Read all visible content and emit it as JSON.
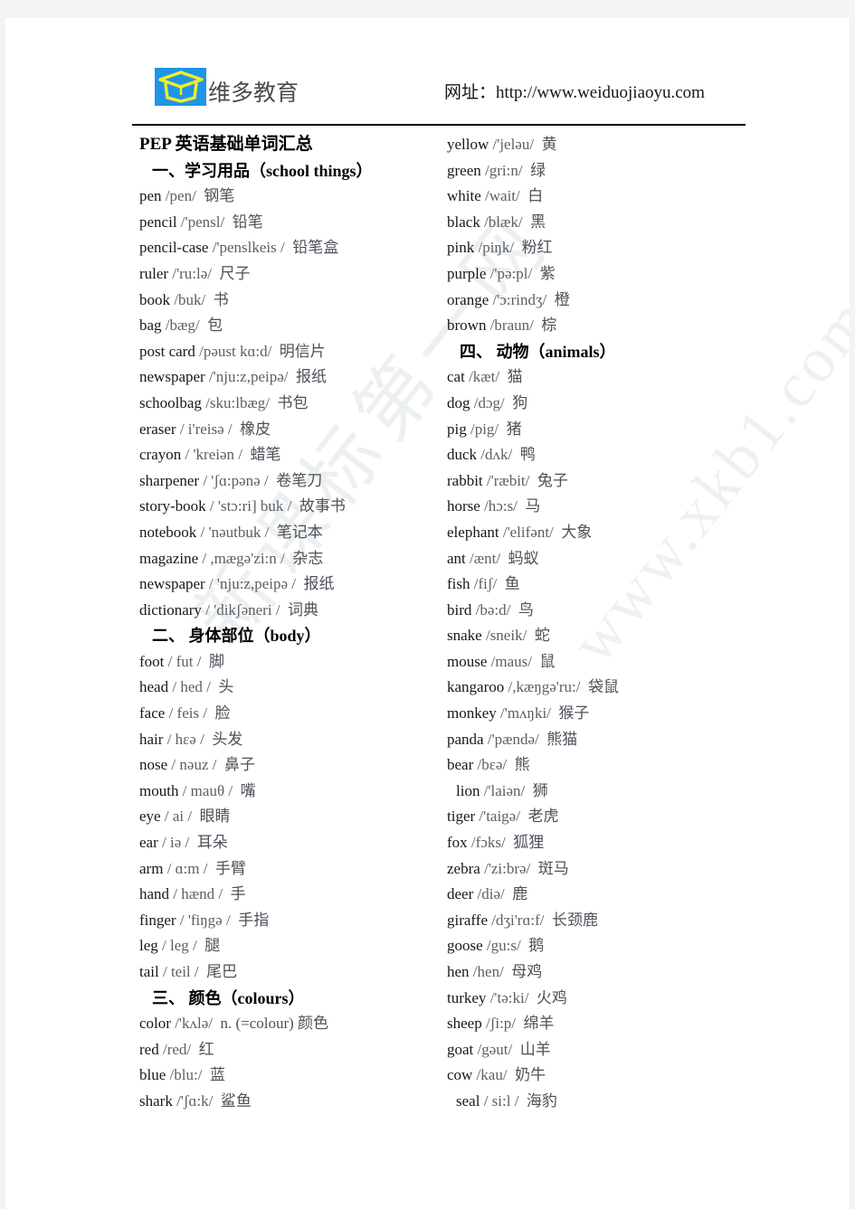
{
  "header": {
    "logo_icon": "graduation-cap-logo-icon",
    "brand_name": "维多教育",
    "site_url": "网址：http://www.weiduojiaoyu.com",
    "logo_bg_color": "#1f95e8",
    "logo_mark_color": "#f7ee22"
  },
  "watermarks": {
    "chinese": "新课标第一网",
    "english": "www.xkb1.com"
  },
  "document": {
    "title": "PEP 英语基础单词汇总"
  },
  "left_column": [
    {
      "type": "title",
      "text": "PEP 英语基础单词汇总"
    },
    {
      "type": "section",
      "text": "一、学习用品（school  things）"
    },
    {
      "type": "entry",
      "word": "pen",
      "ipa": "/pen/",
      "cn": "钢笔"
    },
    {
      "type": "entry",
      "word": "pencil",
      "ipa": "/'pensl/",
      "cn": "铅笔"
    },
    {
      "type": "entry",
      "word": "pencil-case",
      "ipa": "/'penslkeis /",
      "cn": "铅笔盒"
    },
    {
      "type": "entry",
      "word": "ruler",
      "ipa": "/'ru:lə/",
      "cn": "尺子"
    },
    {
      "type": "entry",
      "word": "book",
      "ipa": "/buk/",
      "cn": "书"
    },
    {
      "type": "entry",
      "word": "bag",
      "ipa": "/bæg/",
      "cn": "包"
    },
    {
      "type": "entry",
      "word": "post card",
      "ipa": "/pəust kɑ:d/",
      "cn": "明信片"
    },
    {
      "type": "entry",
      "word": "newspaper",
      "ipa": "/'nju:z,peipə/",
      "cn": "报纸"
    },
    {
      "type": "entry",
      "word": "schoolbag",
      "ipa": "/sku:lbæg/",
      "cn": "书包"
    },
    {
      "type": "entry",
      "word": "eraser",
      "ipa": "/ i'reisə /",
      "cn": "橡皮"
    },
    {
      "type": "entry",
      "word": "crayon",
      "ipa": "/ 'kreiən /",
      "cn": "蜡笔"
    },
    {
      "type": "entry",
      "word": "sharpener",
      "ipa": "/ 'ʃɑ:pənə /",
      "cn": "卷笔刀"
    },
    {
      "type": "entry",
      "word": "story-book",
      "ipa": "/ 'stɔ:ri] buk /",
      "cn": "故事书"
    },
    {
      "type": "entry",
      "word": "notebook",
      "ipa": "/ 'nəutbuk /",
      "cn": "笔记本"
    },
    {
      "type": "entry",
      "word": "magaᴢine",
      "ipa": "/ ,mægə'zi:n /",
      "cn": "杂志"
    },
    {
      "type": "entry",
      "word": "newspaper",
      "ipa": "/ 'nju:ᴢ,peipə /",
      "cn": "报纸"
    },
    {
      "type": "entry",
      "word": "dictionary",
      "ipa": "/ 'dikʃəneri /",
      "cn": "词典"
    },
    {
      "type": "section",
      "text": "二、 身体部位（body）"
    },
    {
      "type": "entry",
      "word": "foot",
      "ipa": "/ fut /",
      "cn": "脚"
    },
    {
      "type": "entry",
      "word": "head",
      "ipa": "/ hed /",
      "cn": "头"
    },
    {
      "type": "entry",
      "word": "face",
      "ipa": "/ feis /",
      "cn": "脸"
    },
    {
      "type": "entry",
      "word": "hair",
      "ipa": "/ hɛə /",
      "cn": "头发"
    },
    {
      "type": "entry",
      "word": "nose",
      "ipa": "/ nəuz /",
      "cn": "鼻子"
    },
    {
      "type": "entry",
      "word": "mouth",
      "ipa": "/ mauθ /",
      "cn": "嘴"
    },
    {
      "type": "entry",
      "word": "eye",
      "ipa": "/ ai /",
      "cn": "眼睛"
    },
    {
      "type": "entry",
      "word": "ear",
      "ipa": "/ iə /",
      "cn": "耳朵"
    },
    {
      "type": "entry",
      "word": "arm",
      "ipa": "/ ɑ:m /",
      "cn": "手臂"
    },
    {
      "type": "entry",
      "word": "hand",
      "ipa": "/ hænd /",
      "cn": "手"
    },
    {
      "type": "entry",
      "word": "finger",
      "ipa": "/ 'fiŋgə /",
      "cn": "手指"
    },
    {
      "type": "entry",
      "word": "leg",
      "ipa": "/ leg /",
      "cn": "腿"
    },
    {
      "type": "entry",
      "word": "tail",
      "ipa": "/ teil /",
      "cn": "尾巴"
    },
    {
      "type": "section",
      "text": "三、 颜色（colours）"
    },
    {
      "type": "entry",
      "word": "color",
      "ipa": "/'kʌlə/",
      "cn": "n. (=colour) 颜色"
    },
    {
      "type": "entry",
      "word": "red",
      "ipa": "/red/",
      "cn": "红"
    },
    {
      "type": "entry",
      "word": "blue",
      "ipa": "/blu:/",
      "cn": "蓝"
    },
    {
      "type": "entry",
      "word": "shark",
      "ipa": "/'ʃɑ:k/",
      "cn": "鲨鱼"
    }
  ],
  "right_column": [
    {
      "type": "entry",
      "word": "yellow",
      "ipa": "/'jeləu/",
      "cn": "黄"
    },
    {
      "type": "entry",
      "word": "green",
      "ipa": "/gri:n/",
      "cn": "绿"
    },
    {
      "type": "entry",
      "word": "white",
      "ipa": "/wait/",
      "cn": "白"
    },
    {
      "type": "entry",
      "word": "black",
      "ipa": "/blæk/",
      "cn": "黑"
    },
    {
      "type": "entry",
      "word": "pink",
      "ipa": "/piŋk/",
      "cn": "粉红"
    },
    {
      "type": "entry",
      "word": "purple",
      "ipa": "/'pə:pl/",
      "cn": "紫"
    },
    {
      "type": "entry",
      "word": "orange",
      "ipa": "/'ɔ:rindʒ/",
      "cn": "橙"
    },
    {
      "type": "entry",
      "word": "brown",
      "ipa": "/braun/",
      "cn": "棕"
    },
    {
      "type": "section",
      "text": "四、 动物（animals）"
    },
    {
      "type": "entry",
      "word": "cat",
      "ipa": "/kæt/",
      "cn": "猫"
    },
    {
      "type": "entry",
      "word": "dog",
      "ipa": "/dɔg/",
      "cn": "狗"
    },
    {
      "type": "entry",
      "word": "pig",
      "ipa": "/pig/",
      "cn": "猪"
    },
    {
      "type": "entry",
      "word": "duck",
      "ipa": "/dʌk/",
      "cn": "鸭"
    },
    {
      "type": "entry",
      "word": "rabbit",
      "ipa": "/'ræbit/",
      "cn": "兔子"
    },
    {
      "type": "entry",
      "word": "horse",
      "ipa": "/hɔ:s/",
      "cn": "马"
    },
    {
      "type": "entry",
      "word": "elephant",
      "ipa": "/'elifənt/",
      "cn": "大象"
    },
    {
      "type": "entry",
      "word": "ant",
      "ipa": "/ænt/",
      "cn": "蚂蚁"
    },
    {
      "type": "entry",
      "word": "fish",
      "ipa": "/fiʃ/",
      "cn": "鱼"
    },
    {
      "type": "entry",
      "word": "bird",
      "ipa": "/bə:d/",
      "cn": "鸟"
    },
    {
      "type": "entry",
      "word": "snake",
      "ipa": "/sneik/",
      "cn": "蛇"
    },
    {
      "type": "entry",
      "word": "mouse",
      "ipa": "/maus/",
      "cn": "鼠"
    },
    {
      "type": "entry",
      "word": "kangaroo",
      "ipa": "/,kæŋgə'ru:/",
      "cn": "袋鼠"
    },
    {
      "type": "entry",
      "word": "monkey",
      "ipa": "/'mʌŋki/",
      "cn": "猴子"
    },
    {
      "type": "entry",
      "word": "panda",
      "ipa": "/'pændə/",
      "cn": "熊猫"
    },
    {
      "type": "entry",
      "word": "bear",
      "ipa": "/bɛə/",
      "cn": "熊"
    },
    {
      "type": "entry",
      "word": "lion",
      "ipa": "/'laiən/",
      "cn": "狮",
      "indent": true
    },
    {
      "type": "entry",
      "word": "tiger",
      "ipa": "/'taigə/",
      "cn": "老虎"
    },
    {
      "type": "entry",
      "word": "fox",
      "ipa": "/fɔks/",
      "cn": "狐狸"
    },
    {
      "type": "entry",
      "word": "ᴢebra",
      "ipa": "/'ᴢi:brə/",
      "cn": "斑马"
    },
    {
      "type": "entry",
      "word": "deer",
      "ipa": "/diə/",
      "cn": "鹿"
    },
    {
      "type": "entry",
      "word": "giraffe",
      "ipa": "/dʒi'rɑ:f/",
      "cn": "长颈鹿"
    },
    {
      "type": "entry",
      "word": "goose",
      "ipa": "/gu:s/",
      "cn": "鹅"
    },
    {
      "type": "entry",
      "word": "hen",
      "ipa": "/hen/",
      "cn": "母鸡"
    },
    {
      "type": "entry",
      "word": "turkey",
      "ipa": "/'tə:ki/",
      "cn": "火鸡"
    },
    {
      "type": "entry",
      "word": "sheep",
      "ipa": "/ʃi:p/",
      "cn": "绵羊"
    },
    {
      "type": "entry",
      "word": "goat",
      "ipa": "/gəut/",
      "cn": "山羊"
    },
    {
      "type": "entry",
      "word": "cow",
      "ipa": "/kau/",
      "cn": "奶牛"
    },
    {
      "type": "entry",
      "word": "seal",
      "ipa": "/ si:l /",
      "cn": "海豹",
      "indent": true
    }
  ]
}
